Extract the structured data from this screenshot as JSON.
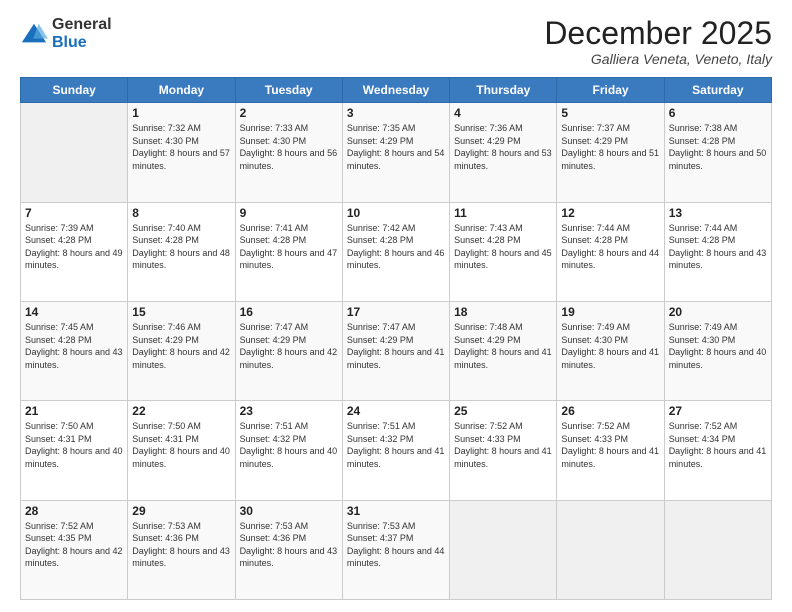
{
  "logo": {
    "general": "General",
    "blue": "Blue"
  },
  "header": {
    "month": "December 2025",
    "location": "Galliera Veneta, Veneto, Italy"
  },
  "weekdays": [
    "Sunday",
    "Monday",
    "Tuesday",
    "Wednesday",
    "Thursday",
    "Friday",
    "Saturday"
  ],
  "weeks": [
    [
      {
        "day": "",
        "info": ""
      },
      {
        "day": "1",
        "info": "Sunrise: 7:32 AM\nSunset: 4:30 PM\nDaylight: 8 hours\nand 57 minutes."
      },
      {
        "day": "2",
        "info": "Sunrise: 7:33 AM\nSunset: 4:30 PM\nDaylight: 8 hours\nand 56 minutes."
      },
      {
        "day": "3",
        "info": "Sunrise: 7:35 AM\nSunset: 4:29 PM\nDaylight: 8 hours\nand 54 minutes."
      },
      {
        "day": "4",
        "info": "Sunrise: 7:36 AM\nSunset: 4:29 PM\nDaylight: 8 hours\nand 53 minutes."
      },
      {
        "day": "5",
        "info": "Sunrise: 7:37 AM\nSunset: 4:29 PM\nDaylight: 8 hours\nand 51 minutes."
      },
      {
        "day": "6",
        "info": "Sunrise: 7:38 AM\nSunset: 4:28 PM\nDaylight: 8 hours\nand 50 minutes."
      }
    ],
    [
      {
        "day": "7",
        "info": "Sunrise: 7:39 AM\nSunset: 4:28 PM\nDaylight: 8 hours\nand 49 minutes."
      },
      {
        "day": "8",
        "info": "Sunrise: 7:40 AM\nSunset: 4:28 PM\nDaylight: 8 hours\nand 48 minutes."
      },
      {
        "day": "9",
        "info": "Sunrise: 7:41 AM\nSunset: 4:28 PM\nDaylight: 8 hours\nand 47 minutes."
      },
      {
        "day": "10",
        "info": "Sunrise: 7:42 AM\nSunset: 4:28 PM\nDaylight: 8 hours\nand 46 minutes."
      },
      {
        "day": "11",
        "info": "Sunrise: 7:43 AM\nSunset: 4:28 PM\nDaylight: 8 hours\nand 45 minutes."
      },
      {
        "day": "12",
        "info": "Sunrise: 7:44 AM\nSunset: 4:28 PM\nDaylight: 8 hours\nand 44 minutes."
      },
      {
        "day": "13",
        "info": "Sunrise: 7:44 AM\nSunset: 4:28 PM\nDaylight: 8 hours\nand 43 minutes."
      }
    ],
    [
      {
        "day": "14",
        "info": "Sunrise: 7:45 AM\nSunset: 4:28 PM\nDaylight: 8 hours\nand 43 minutes."
      },
      {
        "day": "15",
        "info": "Sunrise: 7:46 AM\nSunset: 4:29 PM\nDaylight: 8 hours\nand 42 minutes."
      },
      {
        "day": "16",
        "info": "Sunrise: 7:47 AM\nSunset: 4:29 PM\nDaylight: 8 hours\nand 42 minutes."
      },
      {
        "day": "17",
        "info": "Sunrise: 7:47 AM\nSunset: 4:29 PM\nDaylight: 8 hours\nand 41 minutes."
      },
      {
        "day": "18",
        "info": "Sunrise: 7:48 AM\nSunset: 4:29 PM\nDaylight: 8 hours\nand 41 minutes."
      },
      {
        "day": "19",
        "info": "Sunrise: 7:49 AM\nSunset: 4:30 PM\nDaylight: 8 hours\nand 41 minutes."
      },
      {
        "day": "20",
        "info": "Sunrise: 7:49 AM\nSunset: 4:30 PM\nDaylight: 8 hours\nand 40 minutes."
      }
    ],
    [
      {
        "day": "21",
        "info": "Sunrise: 7:50 AM\nSunset: 4:31 PM\nDaylight: 8 hours\nand 40 minutes."
      },
      {
        "day": "22",
        "info": "Sunrise: 7:50 AM\nSunset: 4:31 PM\nDaylight: 8 hours\nand 40 minutes."
      },
      {
        "day": "23",
        "info": "Sunrise: 7:51 AM\nSunset: 4:32 PM\nDaylight: 8 hours\nand 40 minutes."
      },
      {
        "day": "24",
        "info": "Sunrise: 7:51 AM\nSunset: 4:32 PM\nDaylight: 8 hours\nand 41 minutes."
      },
      {
        "day": "25",
        "info": "Sunrise: 7:52 AM\nSunset: 4:33 PM\nDaylight: 8 hours\nand 41 minutes."
      },
      {
        "day": "26",
        "info": "Sunrise: 7:52 AM\nSunset: 4:33 PM\nDaylight: 8 hours\nand 41 minutes."
      },
      {
        "day": "27",
        "info": "Sunrise: 7:52 AM\nSunset: 4:34 PM\nDaylight: 8 hours\nand 41 minutes."
      }
    ],
    [
      {
        "day": "28",
        "info": "Sunrise: 7:52 AM\nSunset: 4:35 PM\nDaylight: 8 hours\nand 42 minutes."
      },
      {
        "day": "29",
        "info": "Sunrise: 7:53 AM\nSunset: 4:36 PM\nDaylight: 8 hours\nand 43 minutes."
      },
      {
        "day": "30",
        "info": "Sunrise: 7:53 AM\nSunset: 4:36 PM\nDaylight: 8 hours\nand 43 minutes."
      },
      {
        "day": "31",
        "info": "Sunrise: 7:53 AM\nSunset: 4:37 PM\nDaylight: 8 hours\nand 44 minutes."
      },
      {
        "day": "",
        "info": ""
      },
      {
        "day": "",
        "info": ""
      },
      {
        "day": "",
        "info": ""
      }
    ]
  ]
}
